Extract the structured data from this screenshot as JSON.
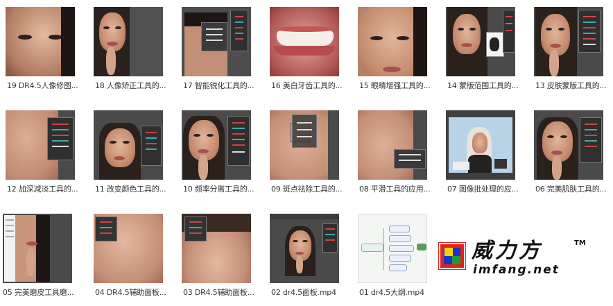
{
  "files": [
    {
      "label": "19 DR4.5人像修图..."
    },
    {
      "label": "18 人像矫正工具的..."
    },
    {
      "label": "17 智能锐化工具的..."
    },
    {
      "label": "16 美白牙齿工具的..."
    },
    {
      "label": "15 眼睛增强工具的..."
    },
    {
      "label": "14 蒙版范围工具的..."
    },
    {
      "label": "13 皮肤蒙版工具的..."
    },
    {
      "label": "12 加深减淡工具的..."
    },
    {
      "label": "11 改变颜色工具的..."
    },
    {
      "label": "10 频率分离工具的..."
    },
    {
      "label": "09 斑点祛除工具的..."
    },
    {
      "label": "08 平滑工具的应用..."
    },
    {
      "label": "07 图像批处理的应..."
    },
    {
      "label": "06 完美肌肤工具的..."
    },
    {
      "label": "05 完美磨皮工具磨..."
    },
    {
      "label": "04 DR4.5辅助面板..."
    },
    {
      "label": "03 DR4.5辅助面板..."
    },
    {
      "label": "02 dr4.5面板.mp4"
    },
    {
      "label": "01 dr4.5大纲.mp4"
    }
  ],
  "watermark": {
    "brand_cn": "威力方",
    "tm": "TM",
    "domain": "imfang.net"
  },
  "colors": {
    "logo_red": "#e0231b",
    "logo_blue": "#1c35c8",
    "logo_green": "#1a9a3a",
    "logo_yellow": "#f2d400"
  }
}
